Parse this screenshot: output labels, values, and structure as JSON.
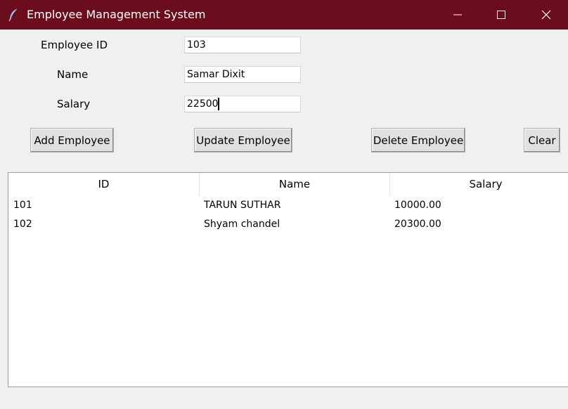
{
  "window": {
    "title": "Employee Management System",
    "titlebar_color": "#6b0d1d",
    "icon": "feather-icon"
  },
  "form": {
    "employee_id_label": "Employee ID",
    "employee_id_value": "103",
    "name_label": "Name",
    "name_value": "Samar Dixit",
    "salary_label": "Salary",
    "salary_value": "22500"
  },
  "buttons": {
    "add": "Add Employee",
    "update": "Update Employee",
    "delete": "Delete Employee",
    "clear": "Clear"
  },
  "table": {
    "columns": [
      "ID",
      "Name",
      "Salary"
    ],
    "rows": [
      [
        "101",
        "TARUN SUTHAR",
        "10000.00"
      ],
      [
        "102",
        "Shyam chandel",
        "20300.00"
      ]
    ]
  }
}
